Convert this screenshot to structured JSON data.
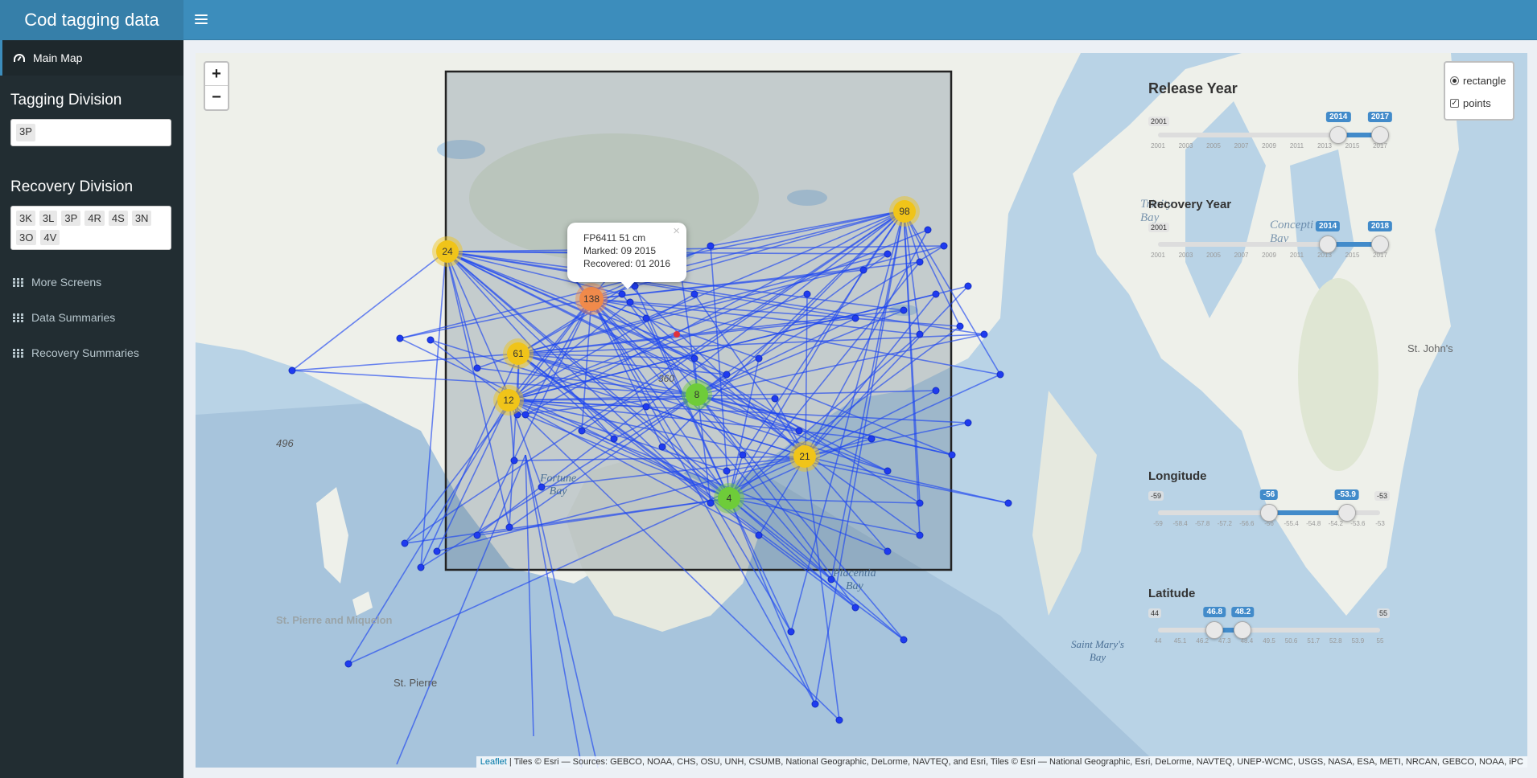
{
  "header": {
    "title": "Cod tagging data"
  },
  "sidebar": {
    "main_map_label": "Main Map",
    "tagging_division": {
      "label": "Tagging Division",
      "selected": [
        "3P"
      ]
    },
    "recovery_division": {
      "label": "Recovery Division",
      "selected": [
        "3K",
        "3L",
        "3P",
        "4R",
        "4S",
        "3N",
        "3O",
        "4V"
      ]
    },
    "menu_items": [
      {
        "label": "More Screens"
      },
      {
        "label": "Data Summaries"
      },
      {
        "label": "Recovery Summaries"
      }
    ]
  },
  "map": {
    "zoom_in": "+",
    "zoom_out": "−",
    "popup": {
      "line1": "FP6411 51 cm",
      "line2": "Marked: 09 2015",
      "line3": "Recovered: 01 2016",
      "close": "×"
    },
    "layers": [
      {
        "label": "rectangle",
        "type": "radio",
        "checked": true
      },
      {
        "label": "points",
        "type": "checkbox",
        "checked": true
      }
    ],
    "clusters": [
      {
        "count": "24",
        "color": "#f0c419"
      },
      {
        "count": "138",
        "color": "#f08a4b"
      },
      {
        "count": "61",
        "color": "#f0c419"
      },
      {
        "count": "12",
        "color": "#f0c419"
      },
      {
        "count": "98",
        "color": "#f0c419"
      },
      {
        "count": "8",
        "color": "#6ecc39"
      },
      {
        "count": "21",
        "color": "#f0c419"
      },
      {
        "count": "4",
        "color": "#6ecc39"
      }
    ],
    "place_labels": {
      "fortune": "Fortune\nBay",
      "placentia": "Placentia\nBay",
      "st_pierre_miquelon": "St. Pierre and Miquelon",
      "st_pierre": "St. Pierre",
      "st_marys": "Saint Mary's\nBay",
      "st_johns": "St. John's",
      "trinity": "Trinity\nBay",
      "conception": "Concepti\nBay",
      "depth_496": "496",
      "depth_360": "360"
    },
    "attribution_link": "Leaflet",
    "attribution_text": " | Tiles © Esri — Sources: GEBCO, NOAA, CHS, OSU, UNH, CSUMB, National Geographic, DeLorme, NAVTEQ, and Esri, Tiles © Esri — National Geographic, Esri, DeLorme, NAVTEQ, UNEP-WCMC, USGS, NASA, ESA, METI, NRCAN, GEBCO, NOAA, iPC"
  },
  "sliders": {
    "release_year": {
      "title": "Release Year",
      "min": "2001",
      "max": "2017",
      "low": "2014",
      "high": "2017",
      "low_frac": 0.8125,
      "high_frac": 1.0,
      "ticks": [
        "2001",
        "2003",
        "2005",
        "2007",
        "2009",
        "2011",
        "2013",
        "2015",
        "2017"
      ]
    },
    "recovery_year": {
      "title": "Recovery Year",
      "min": "2001",
      "max": "2018",
      "low": "2014",
      "high": "2018",
      "low_frac": 0.765,
      "high_frac": 1.0,
      "ticks": [
        "2001",
        "2003",
        "2005",
        "2007",
        "2009",
        "2011",
        "2013",
        "2015",
        "2017"
      ]
    },
    "longitude": {
      "title": "Longitude",
      "min": "-59",
      "max": "-53",
      "low": "-56",
      "high": "-53.9",
      "low_frac": 0.5,
      "high_frac": 0.85,
      "ticks": [
        "-59",
        "-58.4",
        "-57.8",
        "-57.2",
        "-56.6",
        "-56",
        "-55.4",
        "-54.8",
        "-54.2",
        "-53.6",
        "-53"
      ]
    },
    "latitude": {
      "title": "Latitude",
      "min": "44",
      "max": "55",
      "low": "46.8",
      "high": "48.2",
      "low_frac": 0.255,
      "high_frac": 0.382,
      "ticks": [
        "44",
        "45.1",
        "46.2",
        "47.3",
        "48.4",
        "49.5",
        "50.6",
        "51.7",
        "52.8",
        "53.9",
        "55"
      ]
    }
  }
}
